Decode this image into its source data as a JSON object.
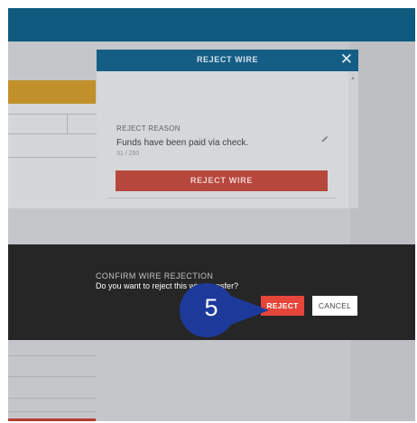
{
  "modal": {
    "title": "REJECT WIRE",
    "close_icon": "close-icon",
    "field_label": "REJECT REASON",
    "field_value": "Funds have been paid via check.",
    "char_count": "31 / 250",
    "edit_icon": "pencil-icon",
    "submit_label": "REJECT WIRE"
  },
  "confirm": {
    "title": "CONFIRM WIRE REJECTION",
    "message": "Do you want to reject this wire transfer?",
    "reject_label": "REJECT",
    "cancel_label": "CANCEL"
  },
  "callout": {
    "step": "5"
  },
  "colors": {
    "header": "#145e86",
    "danger": "#e6463a",
    "overlay": "#262626",
    "callout": "#1d3a9a"
  }
}
